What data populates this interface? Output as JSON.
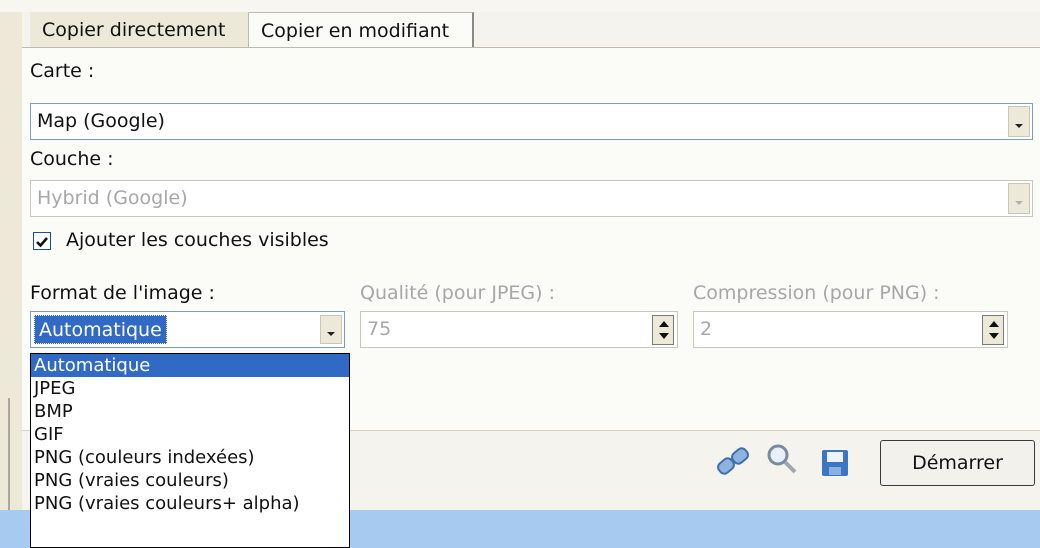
{
  "tabs": {
    "direct": "Copier directement",
    "modify": "Copier en modifiant"
  },
  "map": {
    "label": "Carte :",
    "value": "Map (Google)"
  },
  "layer": {
    "label": "Couche :",
    "value": "Hybrid (Google)"
  },
  "visible_layers": {
    "label": "Ajouter les couches visibles",
    "checked": true
  },
  "format": {
    "label": "Format de l'image :",
    "value": "Automatique",
    "options": [
      "Automatique",
      "JPEG",
      "BMP",
      "GIF",
      "PNG (couleurs indexées)",
      "PNG (vraies couleurs)",
      "PNG (vraies couleurs+ alpha)"
    ]
  },
  "quality": {
    "label": "Qualité (pour JPEG) :",
    "value": "75"
  },
  "compression": {
    "label": "Compression (pour PNG) :",
    "value": "2"
  },
  "start_label": "Démarrer",
  "icons": [
    "link-icon",
    "zoom-icon",
    "save-icon"
  ],
  "colors": {
    "selection": "#316ac5",
    "taskbar": "#a6caf0"
  }
}
